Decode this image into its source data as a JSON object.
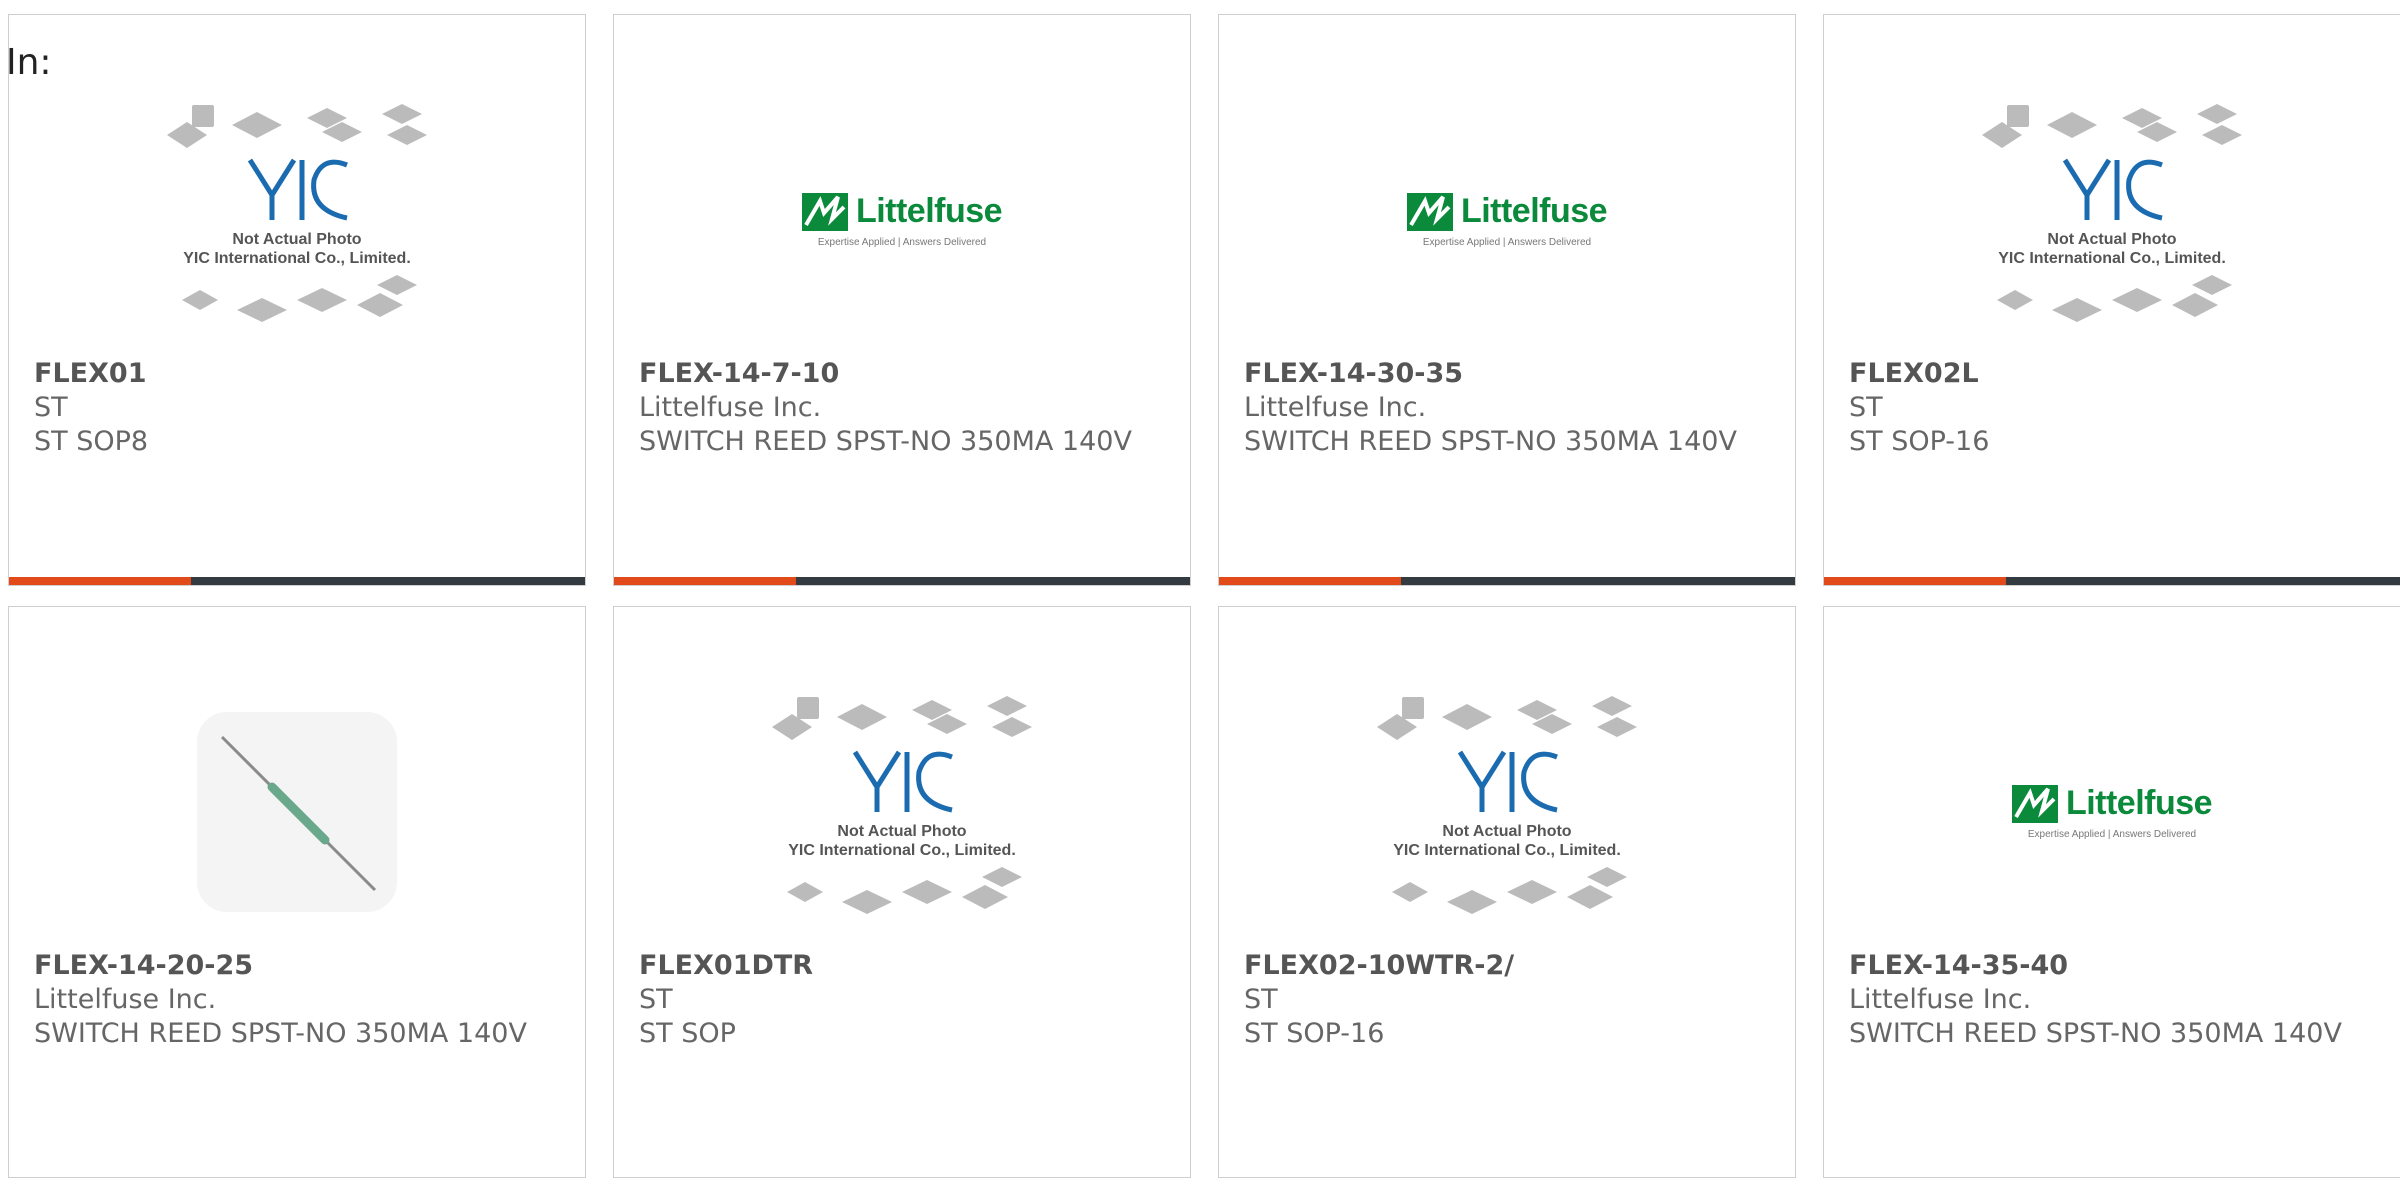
{
  "header": {
    "in_label": "In:"
  },
  "colors": {
    "accent": "#e34a1a",
    "bar": "#333b41",
    "logo_green": "#0b8a3c"
  },
  "placeholder": {
    "line1": "Not Actual Photo",
    "line2": "YIC International Co., Limited."
  },
  "littelfuse": {
    "name": "Littelfuse",
    "tagline": "Expertise Applied | Answers Delivered"
  },
  "products": [
    {
      "part": "FLEX01",
      "mfr": "ST",
      "desc": "ST SOP8",
      "image": "yic-placeholder"
    },
    {
      "part": "FLEX-14-7-10",
      "mfr": "Littelfuse Inc.",
      "desc": "SWITCH REED SPST-NO 350MA 140V",
      "image": "littelfuse-logo"
    },
    {
      "part": "FLEX-14-30-35",
      "mfr": "Littelfuse Inc.",
      "desc": "SWITCH REED SPST-NO 350MA 140V",
      "image": "littelfuse-logo"
    },
    {
      "part": "FLEX02L",
      "mfr": "ST",
      "desc": "ST SOP-16",
      "image": "yic-placeholder"
    },
    {
      "part": "FLEX-14-20-25",
      "mfr": "Littelfuse Inc.",
      "desc": "SWITCH REED SPST-NO 350MA 140V",
      "image": "reed-switch-photo"
    },
    {
      "part": "FLEX01DTR",
      "mfr": "ST",
      "desc": "ST SOP",
      "image": "yic-placeholder"
    },
    {
      "part": "FLEX02-10WTR-2/",
      "mfr": "ST",
      "desc": "ST SOP-16",
      "image": "yic-placeholder"
    },
    {
      "part": "FLEX-14-35-40",
      "mfr": "Littelfuse Inc.",
      "desc": "SWITCH REED SPST-NO 350MA 140V",
      "image": "littelfuse-logo"
    }
  ]
}
